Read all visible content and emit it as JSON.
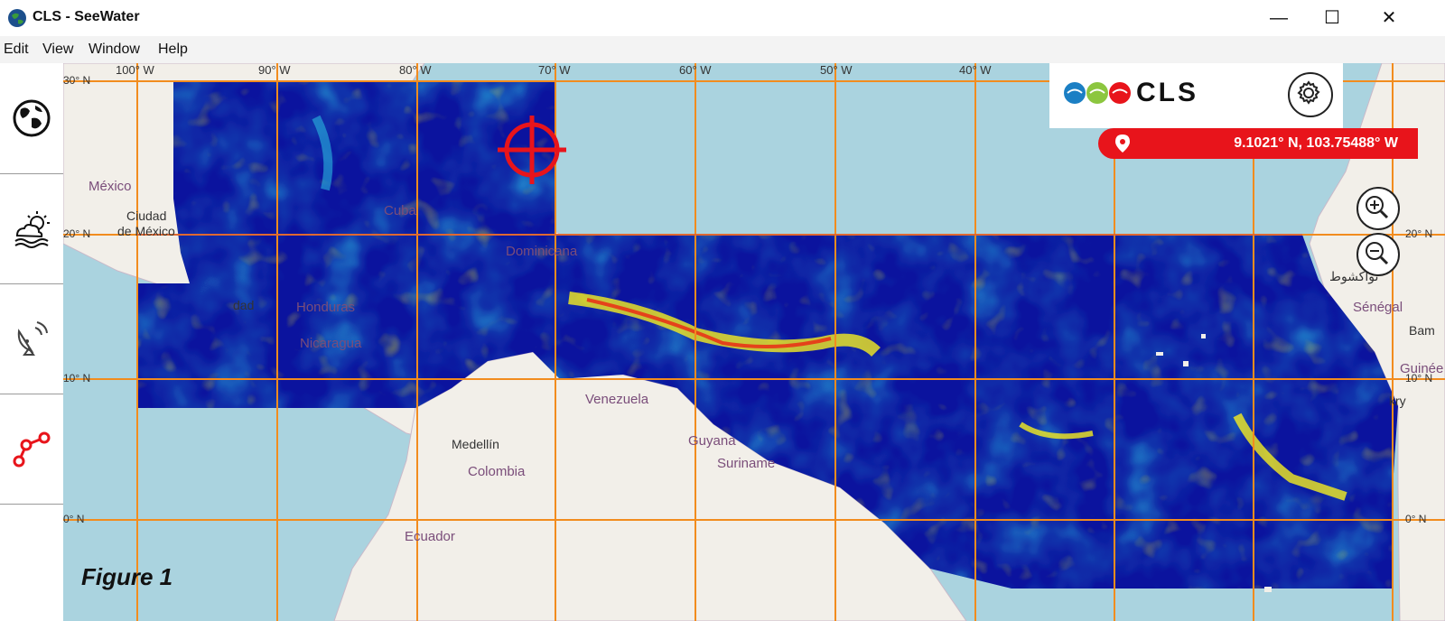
{
  "window": {
    "title": "CLS - SeeWater",
    "minimize_icon": "minimize-icon",
    "maximize_icon": "maximize-icon",
    "close_icon": "close-icon"
  },
  "menu": {
    "items": [
      {
        "label": "Edit"
      },
      {
        "label": "View"
      },
      {
        "label": "Window"
      },
      {
        "label": "Help"
      }
    ]
  },
  "sidebar": {
    "items": [
      {
        "icon": "globe-icon"
      },
      {
        "icon": "weather-icon"
      },
      {
        "icon": "satellite-dish-icon"
      },
      {
        "icon": "route-icon"
      }
    ]
  },
  "map": {
    "longitude_labels": [
      "100° W",
      "90° W",
      "80° W",
      "70° W",
      "60° W",
      "50° W",
      "40° W"
    ],
    "latitude_labels_left": [
      "30° N",
      "20° N",
      "10° N",
      "0° N"
    ],
    "latitude_labels_right": [
      "20° N",
      "10° N",
      "0° N"
    ],
    "place_labels": {
      "mexico": "México",
      "ciudad": "Ciudad",
      "de_mexico": "de México",
      "honduras": "Honduras",
      "nicaragua": "Nicaragua",
      "venezuela": "Venezuela",
      "medellin": "Medellín",
      "colombia": "Colombia",
      "guyana": "Guyana",
      "suriname": "Suriname",
      "ecuador": "Ecuador",
      "senegal": "Sénégal",
      "guinee": "Guinée",
      "cuba": "Cuba",
      "dominicana": "Dominicana",
      "ciudad_side": "dad",
      "nouakchott": "نواكشوط",
      "bamako": "Bam",
      "conakry": "kry"
    },
    "colors": {
      "ocean": "#aad3df",
      "land": "#f2efe9",
      "data_low": "#0b139e",
      "data_mid": "#2ab7e0",
      "data_high": "#f5ee1f",
      "data_peak": "#e83417",
      "grid": "#f28c1e"
    }
  },
  "branding": {
    "logo_text": "CLS",
    "settings_icon": "gear-icon"
  },
  "coordinates": {
    "icon": "location-pin-icon",
    "value": "9.1021° N, 103.75488° W"
  },
  "zoom": {
    "in_icon": "zoom-in-icon",
    "out_icon": "zoom-out-icon"
  },
  "target_icon": "crosshair-target-icon",
  "figure_label": "Figure 1"
}
